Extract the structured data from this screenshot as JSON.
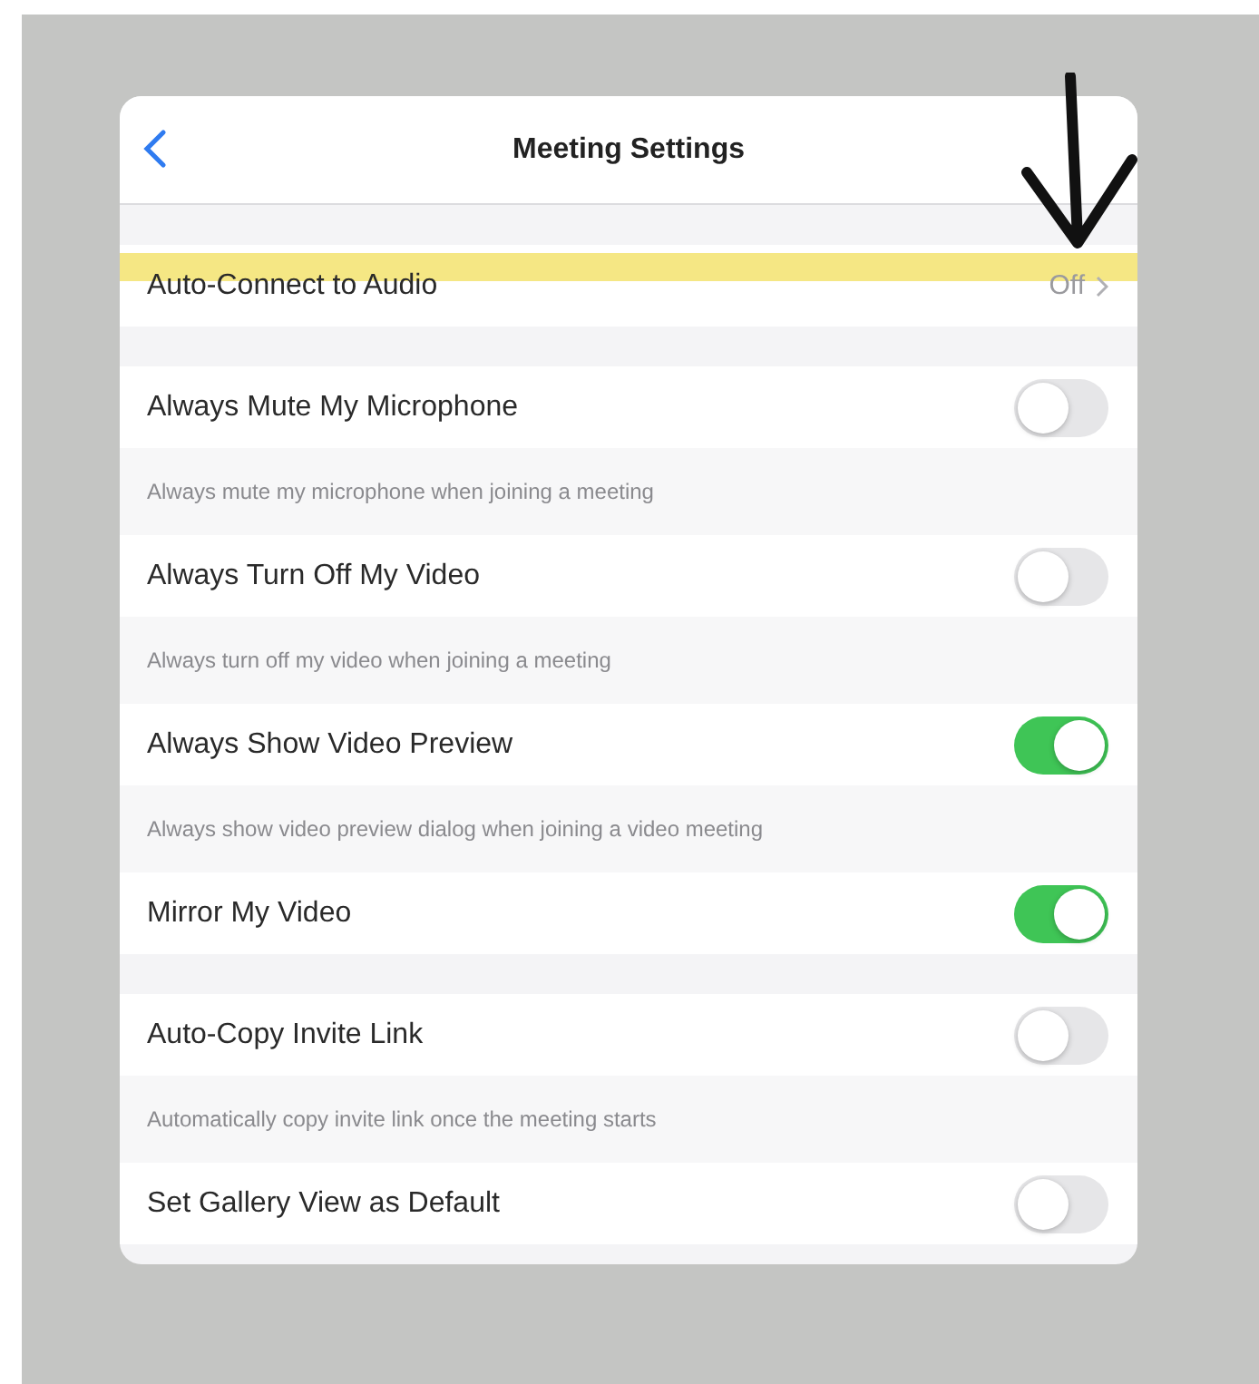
{
  "header": {
    "title": "Meeting Settings"
  },
  "groups": [
    {
      "items": [
        {
          "kind": "disclosure",
          "label": "Auto-Connect to Audio",
          "value": "Off",
          "highlighted": true
        }
      ]
    },
    {
      "items": [
        {
          "kind": "toggle",
          "label": "Always Mute My Microphone",
          "on": false,
          "description": "Always mute my microphone when joining a meeting"
        },
        {
          "kind": "toggle",
          "label": "Always Turn Off My Video",
          "on": false,
          "description": "Always turn off my video when joining a meeting"
        },
        {
          "kind": "toggle",
          "label": "Always Show Video Preview",
          "on": true,
          "description": "Always show video preview dialog when joining a video meeting"
        },
        {
          "kind": "toggle",
          "label": "Mirror My Video",
          "on": true
        }
      ]
    },
    {
      "items": [
        {
          "kind": "toggle",
          "label": "Auto-Copy Invite Link",
          "on": false,
          "description": "Automatically copy invite link once the meeting starts"
        },
        {
          "kind": "toggle",
          "label": "Set Gallery View as Default",
          "on": false
        }
      ]
    }
  ]
}
